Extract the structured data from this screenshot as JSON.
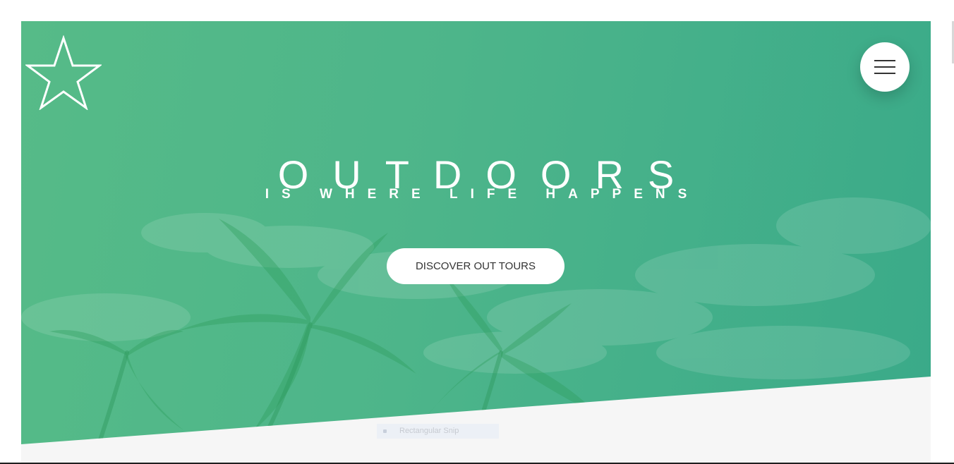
{
  "hero": {
    "title": "OUTDOORS",
    "subtitle": "IS WHERE LIFE HAPPENS",
    "cta_label": "DISCOVER OUT TOURS"
  },
  "icons": {
    "logo": "star-outline-icon",
    "menu": "hamburger-menu-icon"
  },
  "overlay": {
    "snip_label": "Rectangular Snip"
  },
  "colors": {
    "hero_green_start": "#56bb88",
    "hero_green_end": "#3aaa89",
    "section_background": "#f6f6f6",
    "button_background": "#ffffff",
    "button_text": "#333333"
  }
}
